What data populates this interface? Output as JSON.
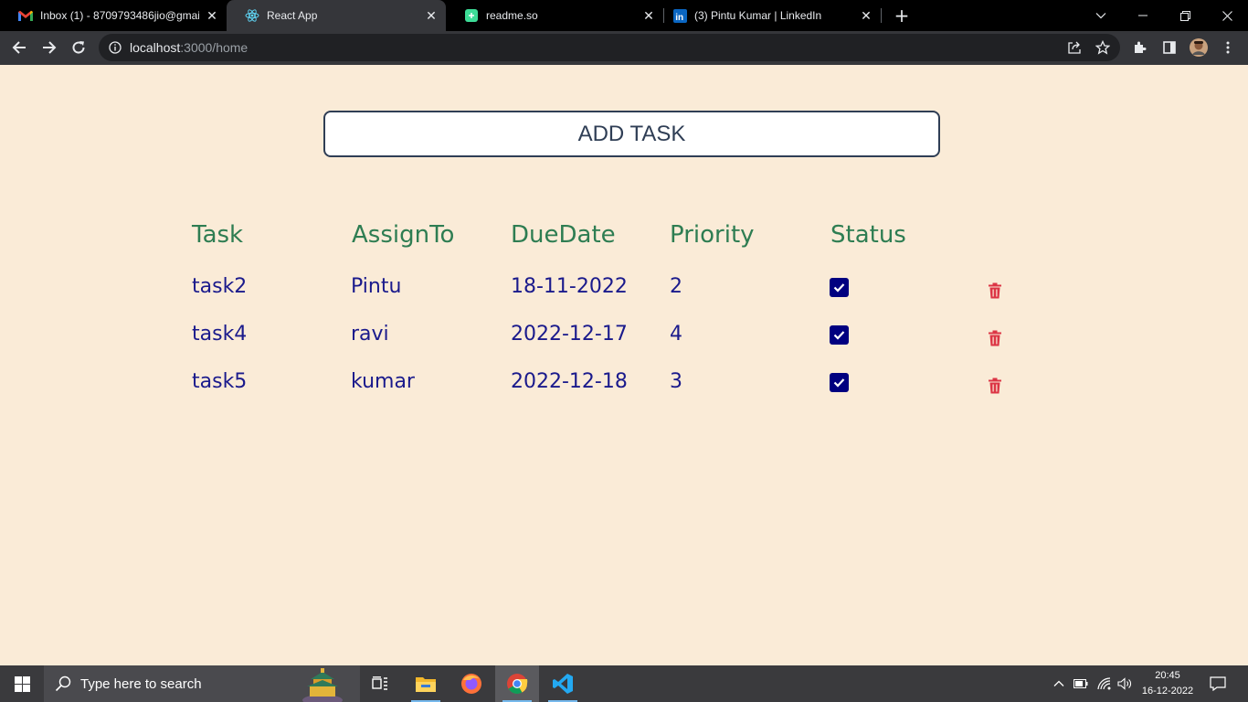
{
  "browser": {
    "tabs": [
      {
        "title": "Inbox (1) - 8709793486jio@gmail",
        "favicon": "gmail-icon",
        "active": false
      },
      {
        "title": "React App",
        "favicon": "react-icon",
        "active": true
      },
      {
        "title": "readme.so",
        "favicon": "readme-icon",
        "active": false
      },
      {
        "title": "(3) Pintu Kumar | LinkedIn",
        "favicon": "linkedin-icon",
        "active": false
      }
    ],
    "url_host": "localhost",
    "url_path": ":3000/home"
  },
  "app": {
    "add_task_label": "ADD TASK",
    "columns": [
      "Task",
      "AssignTo",
      "DueDate",
      "Priority",
      "Status"
    ],
    "rows": [
      {
        "task": "task2",
        "assign": "Pintu",
        "due": "18-11-2022",
        "priority": "2",
        "status": true
      },
      {
        "task": "task4",
        "assign": "ravi",
        "due": "2022-12-17",
        "priority": "4",
        "status": true
      },
      {
        "task": "task5",
        "assign": "kumar",
        "due": "2022-12-18",
        "priority": "3",
        "status": true
      }
    ],
    "colors": {
      "background": "#faebd7",
      "header": "#2e7d52",
      "cell": "#1a1a8c",
      "checkbox": "#000080",
      "delete": "#dc3545"
    }
  },
  "taskbar": {
    "search_placeholder": "Type here to search",
    "time": "20:45",
    "date": "16-12-2022"
  }
}
